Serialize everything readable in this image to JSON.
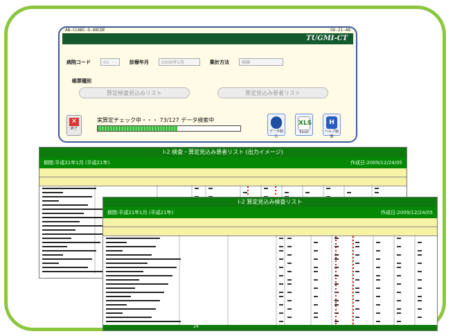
{
  "app": {
    "top_left": "AB-CCABC-G-ABCDE",
    "top_right": "GG-21-AB",
    "title": "TUGMI-CT",
    "dept_label": "病院コード",
    "dept_value": "01",
    "year_label": "診療年月",
    "year_value": "2009年1月",
    "method_label": "集計方法",
    "method_value": "病棟",
    "report_type_label": "帳票種別",
    "btn_list1": "算定検査見込みリスト",
    "btn_list2": "算定見込み患者リスト",
    "status_text": "実算定チェック中・・・ 73/127 データ検索中",
    "progress": 0.56,
    "exit_label": "終了",
    "tool1_label": "データ取込",
    "tool2_label": "Excel",
    "tool3_label": "ヘルプ画面",
    "tool2_icon_text": "XLS"
  },
  "report_back": {
    "title": "Ⅰ-2 検査・算定見込み患者リスト (出力イメージ)",
    "sub_left": "期間:平成21年1月 (平成21年)",
    "sub_right": "作成日:2009/12/24/05"
  },
  "report_front": {
    "title": "Ⅰ-2 算定見込み検査リスト",
    "sub_left": "期間:平成21年1月 (平成21年)",
    "sub_right": "作成日:2009/12/24/05",
    "footer_num": "24"
  }
}
